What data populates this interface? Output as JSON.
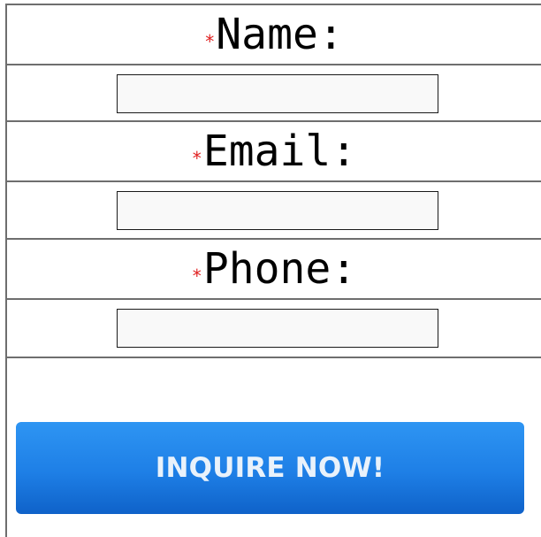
{
  "form": {
    "required_marker": "*",
    "fields": [
      {
        "label": "Name:",
        "value": "",
        "placeholder": ""
      },
      {
        "label": "Email:",
        "value": "",
        "placeholder": ""
      },
      {
        "label": "Phone:",
        "value": "",
        "placeholder": ""
      }
    ],
    "submit_label": "INQUIRE NOW!"
  },
  "colors": {
    "required_marker": "#e02020",
    "button_top": "#2e95f3",
    "button_bottom": "#0f62c9",
    "button_text": "#e9f2fb",
    "field_background": "#f9f9f9",
    "border": "#6e6e6e"
  }
}
